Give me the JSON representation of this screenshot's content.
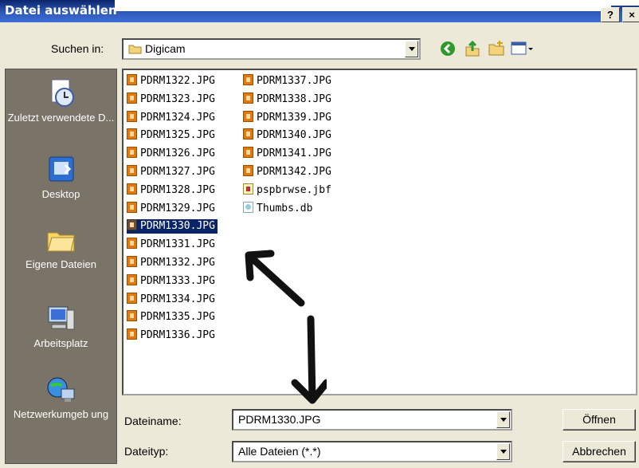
{
  "window": {
    "title": "Datei auswählen",
    "help_glyph": "?",
    "close_glyph": "×"
  },
  "lookin": {
    "label": "Suchen in:",
    "value": "Digicam"
  },
  "places": [
    {
      "label": "Zuletzt verwendete D...",
      "icon": "recent-icon"
    },
    {
      "label": "Desktop",
      "icon": "desktop-icon"
    },
    {
      "label": "Eigene Dateien",
      "icon": "my-documents-icon"
    },
    {
      "label": "Arbeitsplatz",
      "icon": "my-computer-icon"
    },
    {
      "label": "Netzwerkumgeb ung",
      "icon": "network-icon"
    }
  ],
  "files_col1": [
    "PDRM1322.JPG",
    "PDRM1323.JPG",
    "PDRM1324.JPG",
    "PDRM1325.JPG",
    "PDRM1326.JPG",
    "PDRM1327.JPG",
    "PDRM1328.JPG",
    "PDRM1329.JPG",
    "PDRM1330.JPG",
    "PDRM1331.JPG",
    "PDRM1332.JPG",
    "PDRM1333.JPG",
    "PDRM1334.JPG",
    "PDRM1335.JPG",
    "PDRM1336.JPG"
  ],
  "files_col2": [
    "PDRM1337.JPG",
    "PDRM1338.JPG",
    "PDRM1339.JPG",
    "PDRM1340.JPG",
    "PDRM1341.JPG",
    "PDRM1342.JPG",
    "pspbrwse.jbf",
    "Thumbs.db"
  ],
  "selected_file": "PDRM1330.JPG",
  "filename": {
    "label": "Dateiname:",
    "value": "PDRM1330.JPG"
  },
  "filetype": {
    "label": "Dateityp:",
    "value": "Alle Dateien (*.*)"
  },
  "buttons": {
    "open": "Öffnen",
    "cancel": "Abbrechen"
  }
}
